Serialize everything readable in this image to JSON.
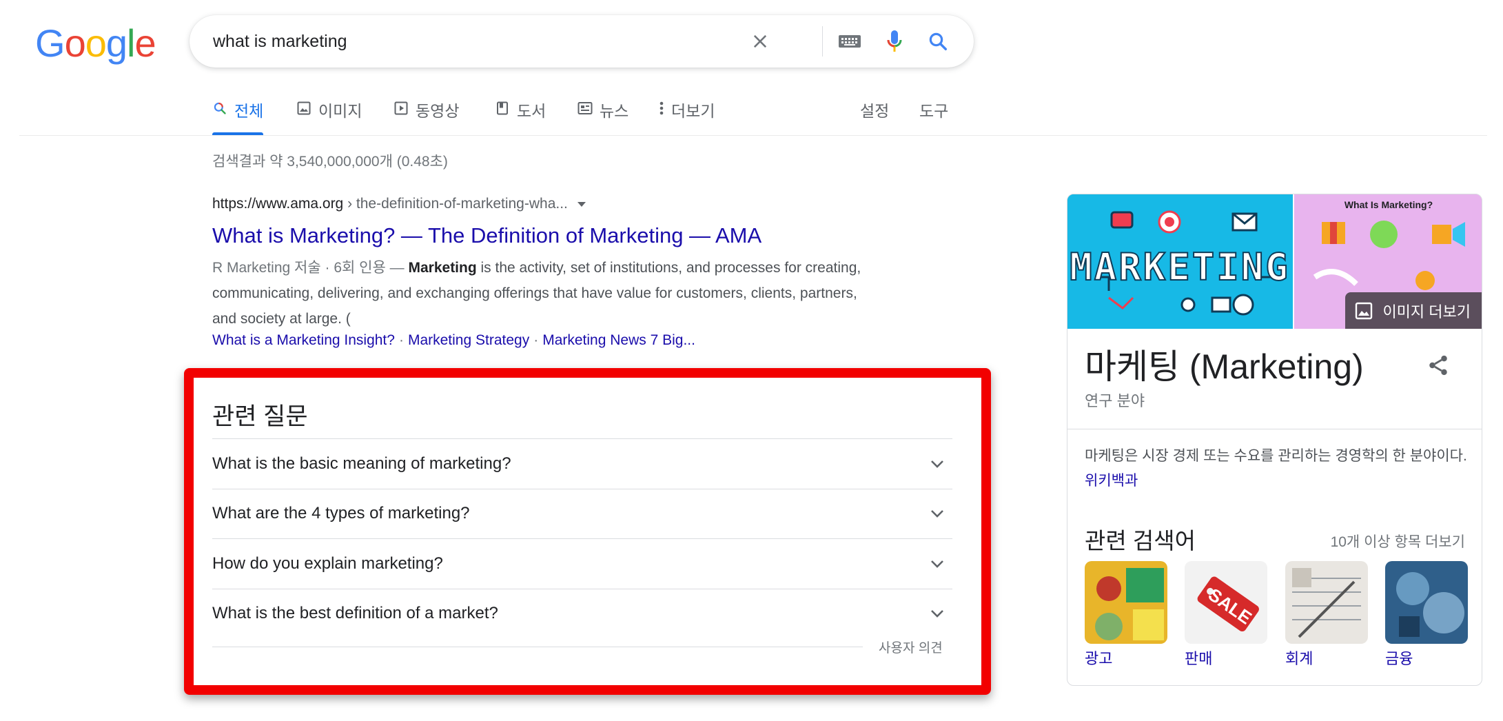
{
  "logo": {
    "text": "Google"
  },
  "search": {
    "query": "what is marketing"
  },
  "icons": {
    "clear": "close-icon",
    "keyboard": "keyboard-icon",
    "mic": "microphone-icon",
    "search": "search-icon"
  },
  "tabs": [
    {
      "label": "전체",
      "icon": "search-icon",
      "active": true
    },
    {
      "label": "이미지",
      "icon": "image-icon"
    },
    {
      "label": "동영상",
      "icon": "video-icon"
    },
    {
      "label": "도서",
      "icon": "book-icon"
    },
    {
      "label": "뉴스",
      "icon": "news-icon"
    },
    {
      "label": "더보기",
      "icon": "more-vert-icon"
    }
  ],
  "tools": {
    "settings": "설정",
    "tools": "도구"
  },
  "result_stats": "검색결과 약 3,540,000,000개 (0.48초)",
  "result": {
    "domain": "https://www.ama.org",
    "path": " › the-definition-of-marketing-wha...",
    "title": "What is Marketing? — The Definition of Marketing — AMA",
    "meta": "R Marketing 저술 · 6회 인용 — ",
    "snippet_bold": "Marketing",
    "snippet_text": " is the activity, set of institutions, and processes for creating, communicating, delivering, and exchanging offerings that have value for customers, clients, partners, and society at large. (",
    "sitelinks": [
      "What is a Marketing Insight?",
      "Marketing Strategy",
      "Marketing News 7 Big..."
    ]
  },
  "paa": {
    "title": "관련 질문",
    "questions": [
      "What is the basic meaning of marketing?",
      "What are the 4 types of marketing?",
      "How do you explain marketing?",
      "What is the best definition of a market?"
    ],
    "feedback": "사용자 의견"
  },
  "knowledge_panel": {
    "image_text": "MARKETING",
    "image2_text": "What Is Marketing?",
    "more_images": "이미지 더보기",
    "title": "마케팅 (Marketing)",
    "subtitle": "연구 분야",
    "description": "마케팅은 시장 경제 또는 수요를 관리하는 경영학의 한 분야이다. ",
    "source_link": "위키백과",
    "related_title": "관련 검색어",
    "related_more": "10개 이상 항목 더보기",
    "related": [
      "광고",
      "판매",
      "회계",
      "금융"
    ],
    "related_colors": [
      "#e8b52a",
      "#f2f2f2",
      "#e9e6e1",
      "#2f5f8a"
    ]
  },
  "colors": {
    "brand_blue": "#4285f4",
    "brand_red": "#ea4335",
    "brand_yellow": "#fbbc05",
    "brand_green": "#34a853",
    "link": "#1a0dab",
    "highlight": "#f20000"
  }
}
